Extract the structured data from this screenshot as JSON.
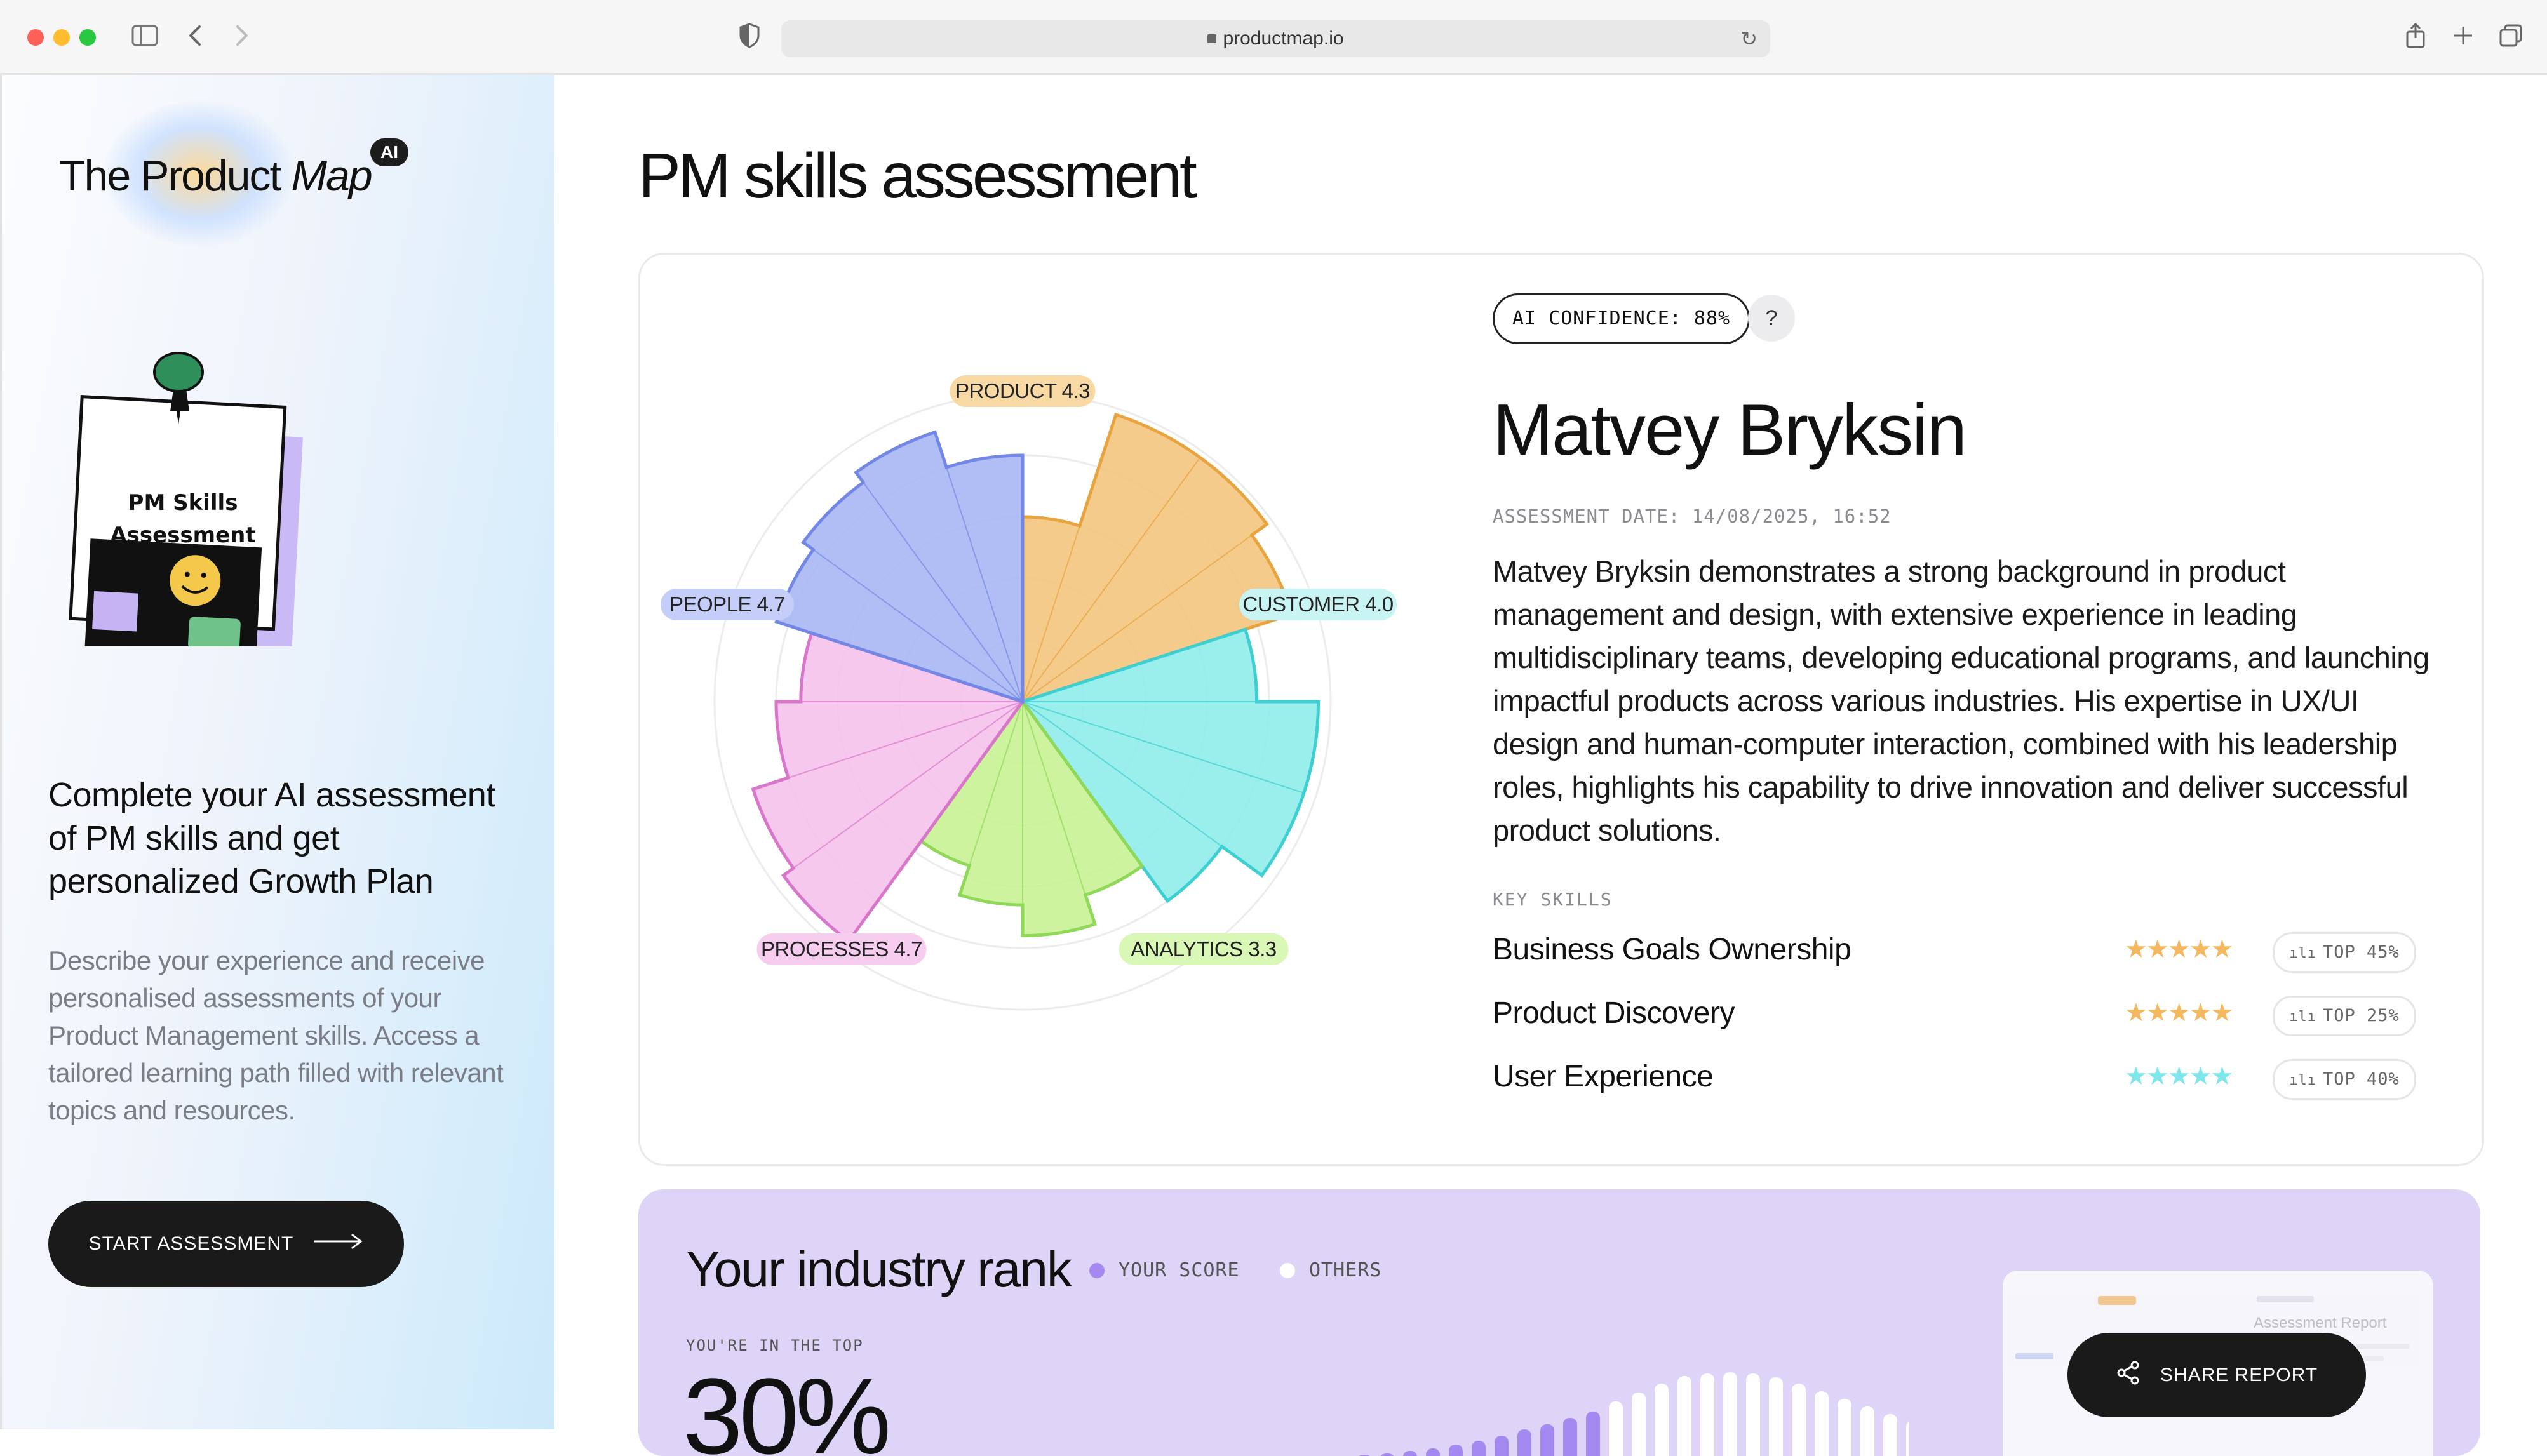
{
  "browser": {
    "url": "productmap.io"
  },
  "sidebar": {
    "logo": {
      "the": "The",
      "product": "Product",
      "map": "Map",
      "badge": "AI"
    },
    "illustration": {
      "title_line1": "PM Skills",
      "title_line2": "Assessment"
    },
    "headline": "Complete your AI assessment of PM skills and get personalized Growth Plan",
    "description": "Describe your experience and receive personalised assessments of your Product Management skills. Access a tailored learning path filled with relevant topics and resources.",
    "start_button": "START ASSESSMENT"
  },
  "main": {
    "title": "PM skills assessment",
    "confidence_badge": "AI CONFIDENCE: 88%",
    "help_label": "?",
    "name": "Matvey Bryksin",
    "assessment_date": "ASSESSMENT DATE: 14/08/2025, 16:52",
    "summary": "Matvey Bryksin demonstrates a strong background in product management and design, with extensive experience in leading multidisciplinary teams, developing educational programs, and launching impactful products across various industries. His expertise in UX/UI design and human-computer interaction, combined with his leadership roles, highlights his capability to drive innovation and deliver successful product solutions.",
    "key_skills_label": "KEY SKILLS",
    "key_skills": [
      {
        "name": "Business Goals Ownership",
        "stars": 5,
        "star_color": "#f4b860",
        "top": "TOP 45%"
      },
      {
        "name": "Product Discovery",
        "stars": 5,
        "star_color": "#f4b860",
        "top": "TOP 25%"
      },
      {
        "name": "User Experience",
        "stars": 5,
        "star_color": "#7fe6ea",
        "top": "TOP 40%"
      }
    ]
  },
  "chart_data": {
    "type": "radar",
    "max": 5,
    "categories": [
      {
        "label": "PRODUCT 4.3",
        "score": 4.3,
        "color": "#f4c57f",
        "stroke": "#e7a43f",
        "label_bg": "#f9d9a3"
      },
      {
        "label": "CUSTOMER 4.0",
        "score": 4.0,
        "color": "#8fecea",
        "stroke": "#3ecfd2",
        "label_bg": "#c9f4f4"
      },
      {
        "label": "ANALYTICS 3.3",
        "score": 3.3,
        "color": "#c8f294",
        "stroke": "#8fd858",
        "label_bg": "#d9f7b5"
      },
      {
        "label": "PROCESSES 4.7",
        "score": 4.7,
        "color": "#f5c2ec",
        "stroke": "#d877c9",
        "label_bg": "#f6cdee"
      },
      {
        "label": "PEOPLE 4.7",
        "score": 4.7,
        "color": "#a9b7f4",
        "stroke": "#7387e6",
        "label_bg": "#c4cef8"
      }
    ],
    "sub_scores": [
      [
        3.0,
        4.9,
        4.9,
        4.6
      ],
      [
        3.8,
        4.8,
        4.8,
        4.0
      ],
      [
        3.3,
        3.8,
        3.3,
        2.8
      ],
      [
        4.8,
        4.6,
        4.0,
        3.6
      ],
      [
        4.2,
        4.4,
        4.6,
        4.0
      ]
    ]
  },
  "rank": {
    "title": "Your industry rank",
    "legend_your_score": "YOUR SCORE",
    "legend_others": "OTHERS",
    "your_score_color": "#a48af0",
    "others_color": "#ffffff",
    "top_label": "YOU'RE IN THE TOP",
    "top_value": "30%",
    "mini_report_title": "Assessment Report"
  },
  "share_button": "SHARE REPORT"
}
